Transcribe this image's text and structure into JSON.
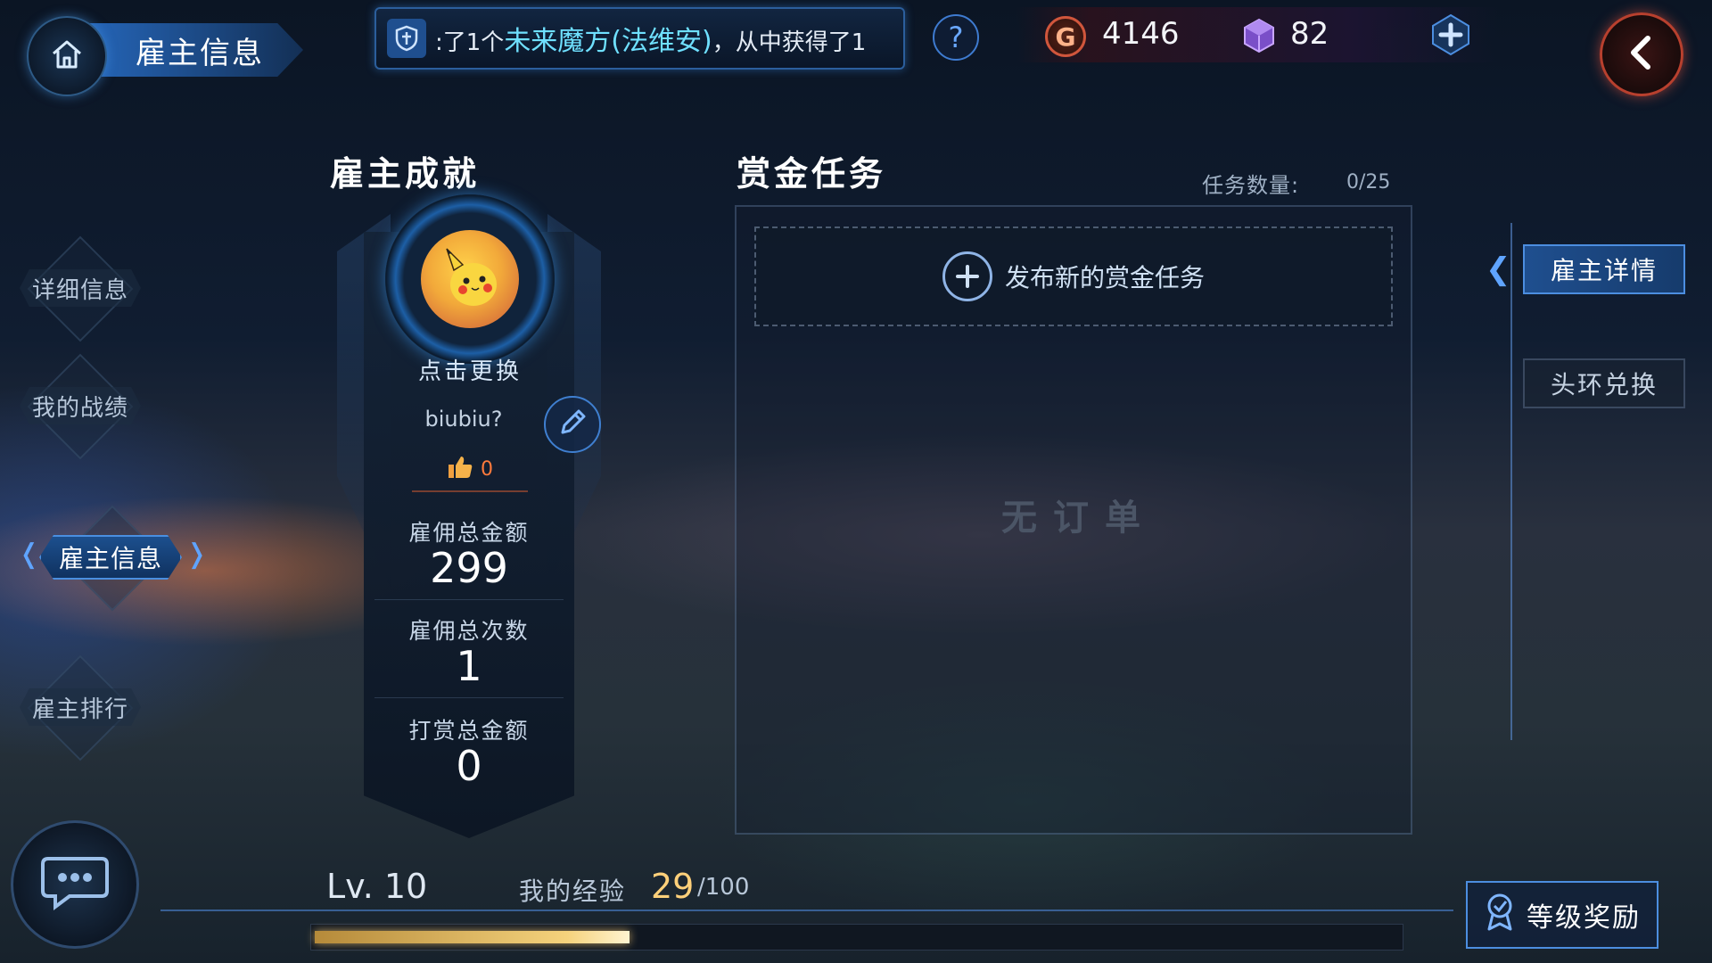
{
  "header": {
    "title": "雇主信息",
    "ticker_prefix": ":了1个",
    "ticker_highlight": "未来魔方(法维安)",
    "ticker_suffix": "，从中获得了1",
    "help_label": "?",
    "gold": "4146",
    "gold_icon_letter": "G",
    "gems": "82"
  },
  "sidebar": {
    "items": [
      {
        "label": "详细信息"
      },
      {
        "label": "我的战绩"
      },
      {
        "label": "雇主信息"
      },
      {
        "label": "雇主排行"
      }
    ]
  },
  "achievement": {
    "title": "雇主成就",
    "change_avatar": "点击更换",
    "username": "biubiu?",
    "likes": "0",
    "stats": [
      {
        "label": "雇佣总金额",
        "value": "299"
      },
      {
        "label": "雇佣总次数",
        "value": "1"
      },
      {
        "label": "打赏总金额",
        "value": "0"
      }
    ]
  },
  "bounty": {
    "title": "赏金任务",
    "task_count_label": "任务数量:",
    "task_count_value": "0/25",
    "publish_label": "发布新的赏金任务",
    "empty_text": "无订单"
  },
  "right_tabs": [
    {
      "label": "雇主详情"
    },
    {
      "label": "头环兑换"
    }
  ],
  "footer": {
    "level": "Lv. 10",
    "exp_label": "我的经验",
    "exp_value": "29",
    "exp_max": "/100",
    "exp_progress": 0.29,
    "reward_label": "等级奖励"
  },
  "colors": {
    "accent": "#4c8ee0",
    "gold_icon": "#d0563c",
    "exp_value": "#ffd07a",
    "like": "#ff7a3c"
  },
  "icons": [
    "home-icon",
    "shield-icon",
    "help-icon",
    "gold-coin-icon",
    "gem-icon",
    "plus-icon",
    "back-arrow-icon",
    "chat-icon",
    "thumbs-up-icon",
    "pencil-icon",
    "plus-circle-icon",
    "medal-icon"
  ]
}
